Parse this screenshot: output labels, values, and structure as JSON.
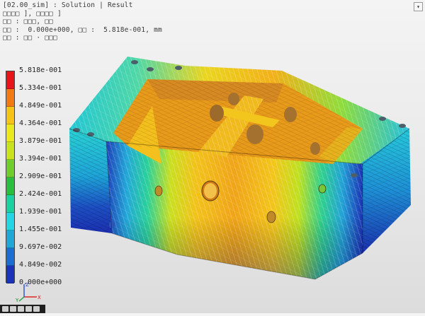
{
  "header": {
    "title": "[02.00_sim] : Solution | Result",
    "line2": "□□□□ ], □□□□ ]",
    "line3": "□□ : □□□, □□",
    "line4": "□□ :  0.000e+000, □□ :  5.818e-001, mm",
    "line5": "□□ : □□ · □□□"
  },
  "legend": {
    "labels": [
      "5.818e-001",
      "5.334e-001",
      "4.849e-001",
      "4.364e-001",
      "3.879e-001",
      "3.394e-001",
      "2.909e-001",
      "2.424e-001",
      "1.939e-001",
      "1.455e-001",
      "9.697e-002",
      "4.849e-002",
      "0.000e+000"
    ],
    "colors": [
      "#e8141c",
      "#f27a12",
      "#f7c318",
      "#ebe81e",
      "#c8e21e",
      "#71cd2b",
      "#29bf3d",
      "#1bd1a0",
      "#24d6e3",
      "#1ea7d8",
      "#1a6ed1",
      "#1b33b8"
    ]
  },
  "triad": {
    "x": "X",
    "y": "Y",
    "z": "Z"
  },
  "window": {
    "close_glyph": "▾"
  }
}
